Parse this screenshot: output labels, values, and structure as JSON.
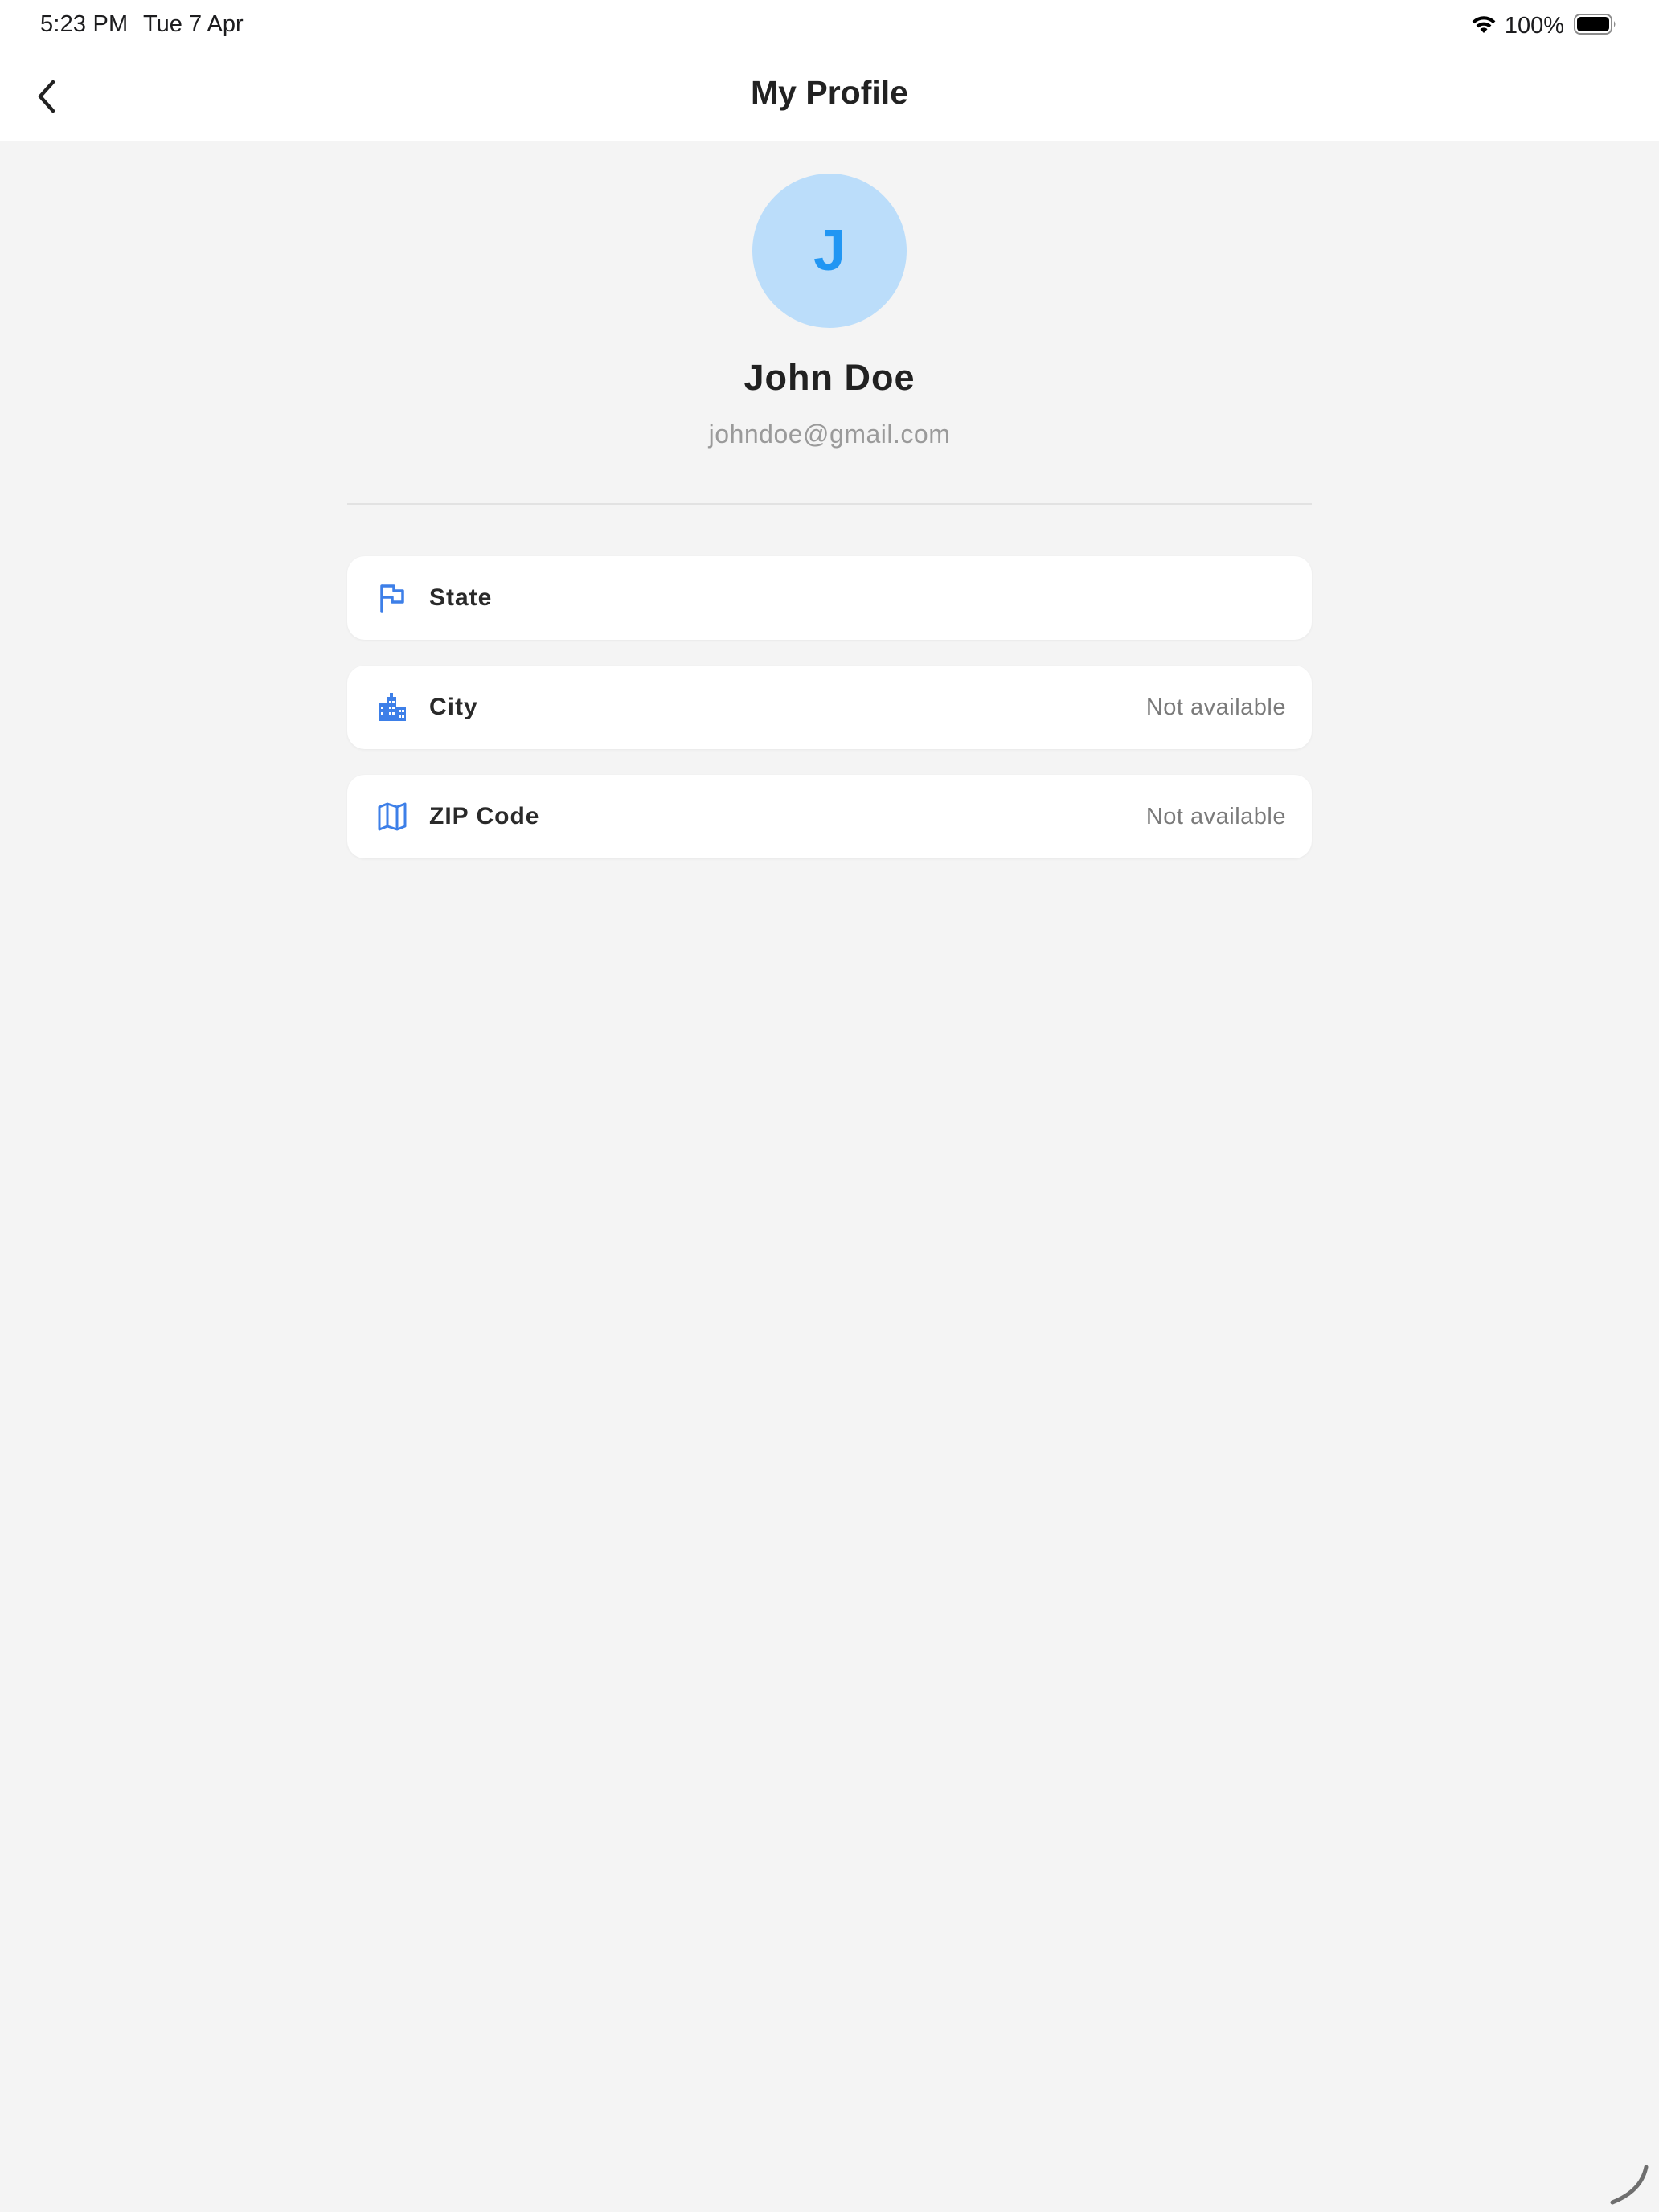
{
  "status_bar": {
    "time": "5:23 PM",
    "date": "Tue 7 Apr",
    "battery": "100%"
  },
  "nav": {
    "title": "My Profile",
    "back_icon": "chevron-left-icon"
  },
  "profile": {
    "initial": "J",
    "name": "John Doe",
    "email": "johndoe@gmail.com",
    "avatar_bg": "#bbddfa",
    "avatar_fg": "#2196f3"
  },
  "details": [
    {
      "label": "State",
      "value": "",
      "icon": "flag-icon"
    },
    {
      "label": "City",
      "value": "Not available",
      "icon": "city-icon"
    },
    {
      "label": "ZIP Code",
      "value": "Not available",
      "icon": "map-icon"
    }
  ],
  "colors": {
    "accent": "#3d7fe8",
    "background": "#f4f4f4",
    "card": "#ffffff"
  }
}
